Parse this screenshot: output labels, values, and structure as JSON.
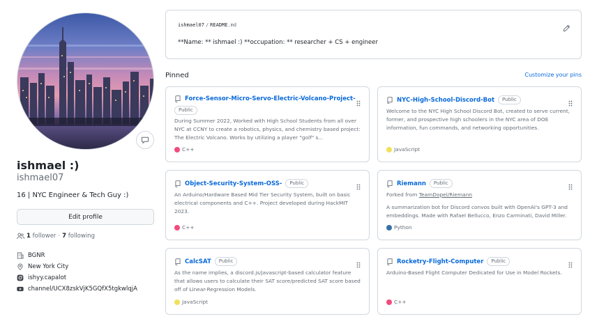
{
  "profile": {
    "display_name": "ishmael :)",
    "username": "ishmael07",
    "bio": "16 | NYC Engineer & Tech Guy :)",
    "edit_button": "Edit profile",
    "followers_count": "1",
    "followers_label": "follower",
    "separator": "·",
    "following_count": "7",
    "following_label": "following",
    "meta": [
      {
        "icon": "organization-icon",
        "text": "BGNR"
      },
      {
        "icon": "location-icon",
        "text": "New York City"
      },
      {
        "icon": "instagram-icon",
        "text": "ishyy.capalot"
      },
      {
        "icon": "youtube-icon",
        "text": "channel/UCX8zskVjK5GQfX5tgkwlqjA"
      }
    ]
  },
  "readme": {
    "owner": "ishmael07",
    "slash": "/",
    "file": "README",
    "ext": ".md",
    "body": "**Name: ** ishmael :) **occupation: ** researcher + CS + engineer"
  },
  "pinned": {
    "title": "Pinned",
    "customize": "Customize your pins",
    "repos": [
      {
        "name": "Force-Sensor-Micro-Servo-Electric-Volcano-Project-",
        "visibility": "Public",
        "description": "During Summer 2022, Worked with High School Students from all over NYC at CCNY to create a robotics, physics, and chemistry based project: The Electric Volcano. Works by utilizing a player \"golf\" s...",
        "language": "C++",
        "language_color": "#f34b7d"
      },
      {
        "name": "NYC-High-School-Discord-Bot",
        "visibility": "Public",
        "description": "Welcome to the NYC High School Discord Bot, created to serve current, former, and prospective high schoolers in the NYC area of DOE information, fun commands, and networking opportunities.",
        "language": "JavaScript",
        "language_color": "#f1e05a"
      },
      {
        "name": "Object-Security-System-OSS-",
        "visibility": "Public",
        "description": "An Arduino/Hardware Based Mid Tier Security System, built on basic electrical components and C++. Project developed during HackMIT 2023.",
        "language": "C++",
        "language_color": "#f34b7d"
      },
      {
        "name": "Riemann",
        "visibility": "Public",
        "forked_prefix": "Forked from",
        "forked_from": "TeamDopel/Riemann",
        "description": "A summarization bot for Discord convos built with OpenAI's GPT-3 and embeddings. Made with Rafael Bellucco, Enzo Carminati, David Miller.",
        "language": "Python",
        "language_color": "#3572A5"
      },
      {
        "name": "CalcSAT",
        "visibility": "Public",
        "description": "As the name implies, a discord.js/javascript-based calculator feature that allows users to calculate their SAT score/predicted SAT score based off of Linear-Regression Models.",
        "language": "JavaScript",
        "language_color": "#f1e05a"
      },
      {
        "name": "Rocketry-Flight-Computer",
        "visibility": "Public",
        "description": "Arduino-Based Flight Computer Dedicated for Use in Model Rockets.",
        "language": "C++",
        "language_color": "#f34b7d"
      }
    ]
  }
}
